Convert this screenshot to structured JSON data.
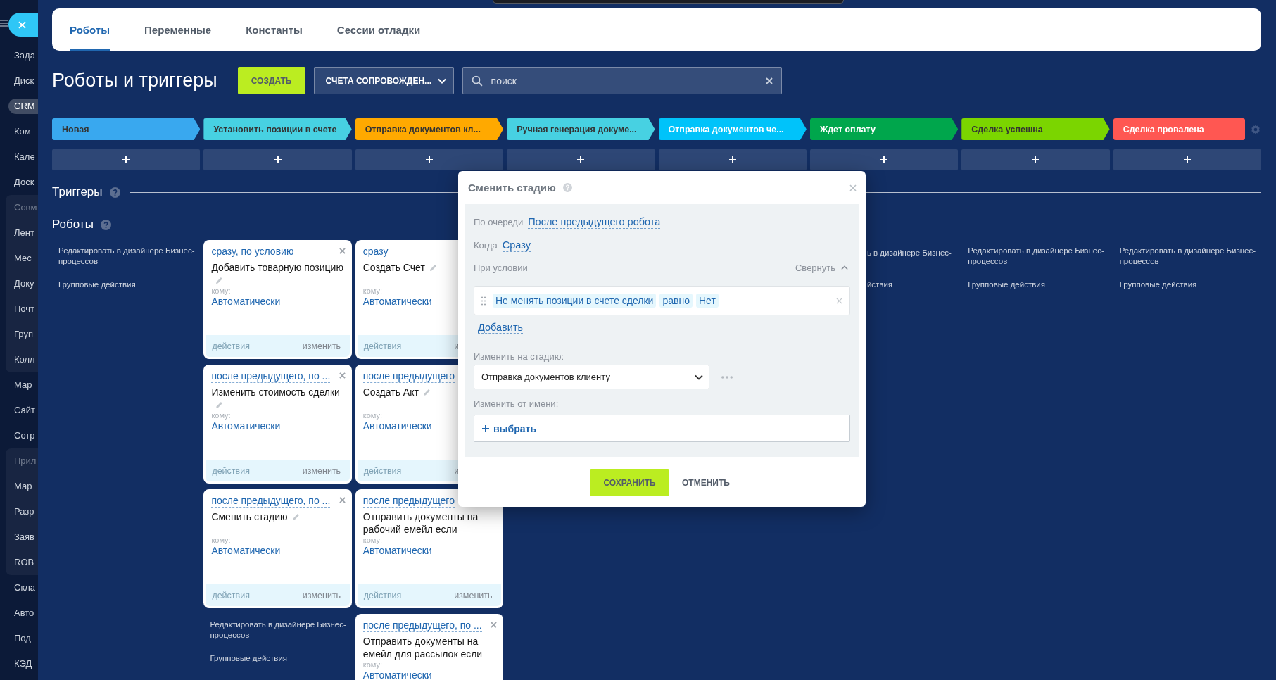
{
  "sidebar": {
    "items": [
      {
        "kind": "item",
        "label": "Зада",
        "selected": false
      },
      {
        "kind": "item",
        "label": "Диск",
        "selected": false
      },
      {
        "kind": "item",
        "label": "CRM",
        "selected": true
      },
      {
        "kind": "item",
        "label": "Ком",
        "selected": false
      },
      {
        "kind": "item",
        "label": "Кале",
        "selected": false
      },
      {
        "kind": "item",
        "label": "Доск",
        "selected": false
      },
      {
        "kind": "group",
        "label": "Совм",
        "children": [
          {
            "label": "Лент",
            "selected": false
          },
          {
            "label": "Мес",
            "selected": false
          },
          {
            "label": "Доку",
            "selected": false
          },
          {
            "label": "Почт",
            "selected": false
          },
          {
            "label": "Груп",
            "selected": false
          },
          {
            "label": "Колл",
            "selected": false
          }
        ]
      },
      {
        "kind": "item",
        "label": "Мар",
        "selected": false
      },
      {
        "kind": "item",
        "label": "Сайт",
        "selected": false
      },
      {
        "kind": "item",
        "label": "Сотр",
        "selected": false
      },
      {
        "kind": "group",
        "label": "Прил",
        "children": [
          {
            "label": "Мар",
            "selected": false
          },
          {
            "label": "Разр",
            "selected": false
          },
          {
            "label": "Заяв",
            "selected": false
          },
          {
            "label": "ROB",
            "selected": false
          }
        ]
      },
      {
        "kind": "item",
        "label": "Скла",
        "selected": false
      },
      {
        "kind": "item",
        "label": "Авто",
        "selected": false
      },
      {
        "kind": "item",
        "label": "Под",
        "selected": false
      },
      {
        "kind": "item",
        "label": "КЭД",
        "selected": false
      }
    ]
  },
  "tabs": [
    {
      "label": "Роботы",
      "selected": true
    },
    {
      "label": "Переменные",
      "selected": false
    },
    {
      "label": "Константы",
      "selected": false
    },
    {
      "label": "Сессии отладки",
      "selected": false
    }
  ],
  "header": {
    "title": "Роботы и триггеры",
    "create_button": "СОЗДАТЬ",
    "category": "СЧЕТА СОПРОВОЖДЕН...",
    "search": {
      "placeholder": "поиск"
    }
  },
  "stages": [
    {
      "name": "Новая",
      "color": "#39a8ef",
      "light_text": false,
      "links": [
        "Редактировать в дизайнере Бизнес-процессов",
        "Групповые действия"
      ]
    },
    {
      "name": "Установить позиции в счете",
      "color": "#47d1e2",
      "light_text": false,
      "robots": [
        {
          "condition": "сразу, по условию",
          "close_icon": true,
          "action": "Добавить товарную позицию",
          "edit_icon": true,
          "to_label": "кому:",
          "to": "Автоматически",
          "actions": {
            "label": "действия",
            "disabled": true
          },
          "edit": "изменить"
        },
        {
          "condition": "после предыдущего, по ...",
          "close_icon": true,
          "action": "Изменить стоимость сделки",
          "edit_icon": true,
          "to_label": "кому:",
          "to": "Автоматически",
          "actions": {
            "label": "действия",
            "disabled": true
          },
          "edit": "изменить"
        },
        {
          "condition": "после предыдущего, по ...",
          "close_icon": true,
          "action": "Сменить стадию",
          "edit_icon": true,
          "to_label": "кому:",
          "to": "Автоматически",
          "actions": {
            "label": "действия",
            "disabled": true
          },
          "edit": "изменить"
        }
      ],
      "links": [
        "Редактировать в дизайнере Бизнес-процессов",
        "Групповые действия"
      ]
    },
    {
      "name": "Отправка документов кл...",
      "color": "#ffa900",
      "light_text": false,
      "robots": [
        {
          "condition": "сразу",
          "close_icon": false,
          "action": "Создать Счет",
          "edit_icon": true,
          "to_label": "кому:",
          "to": "Автоматически",
          "actions": {
            "label": "действия",
            "disabled": true
          },
          "edit": "и"
        },
        {
          "condition": "после предыдущего",
          "close_icon": false,
          "action": "Создать Акт",
          "edit_icon": true,
          "to_label": "кому:",
          "to": "Автоматически",
          "actions": {
            "label": "действия",
            "disabled": true
          },
          "edit": "и"
        },
        {
          "condition": "после предыдущего",
          "close_icon": false,
          "action": "Отправить документы на рабочий емейл если",
          "edit_icon": false,
          "to_label": "кому:",
          "to": "Автоматически",
          "actions": {
            "label": "действия",
            "disabled": true
          },
          "edit": "изменить"
        },
        {
          "condition": "после предыдущего, по ...",
          "close_icon": true,
          "action": "Отправить документы на емейл для рассылок если",
          "edit_icon": false,
          "to_label": "кому:",
          "to": "Автоматически"
        }
      ]
    },
    {
      "name": "Ручная генерация докуме...",
      "color": "#47d1e2",
      "light_text": false
    },
    {
      "name": "Отправка документов че...",
      "color": "#00c3fa",
      "light_text": true
    },
    {
      "name": "Ждет оплату",
      "color": "#00a64c",
      "light_text": true,
      "links": [
        "ь в дизайнере Бизнес-",
        "йствия"
      ]
    },
    {
      "name": "Сделка успешна",
      "color": "#7bd500",
      "light_text": false,
      "links": [
        "Редактировать в дизайнере Бизнес-процессов",
        "Групповые действия"
      ]
    },
    {
      "name": "Сделка провалена",
      "color": "#ff5752",
      "light_text": true,
      "links": [
        "Редактировать в дизайнере Бизнес-процессов",
        "Групповые действия"
      ]
    }
  ],
  "triggers": {
    "title": "Триггеры"
  },
  "robots": {
    "title": "Роботы"
  },
  "dialog": {
    "title": "Сменить стадию",
    "order": {
      "label": "По очереди",
      "value": "После предыдущего робота"
    },
    "when": {
      "label": "Когда",
      "value": "Сразу"
    },
    "condition": {
      "label": "При условии",
      "toggle": "Свернуть",
      "expanded": true,
      "chips": [
        "Не менять позиции в счете сделки",
        "равно",
        "Нет"
      ],
      "add": "Добавить"
    },
    "stage": {
      "label": "Изменить на стадию:",
      "value": "Отправка документов клиенту"
    },
    "author": {
      "label": "Изменить от имени:",
      "action": "выбрать"
    },
    "buttons": [
      {
        "label": "СОХРАНИТЬ",
        "kind": "primary"
      },
      {
        "label": "ОТМЕНИТЬ",
        "kind": "link"
      }
    ]
  }
}
